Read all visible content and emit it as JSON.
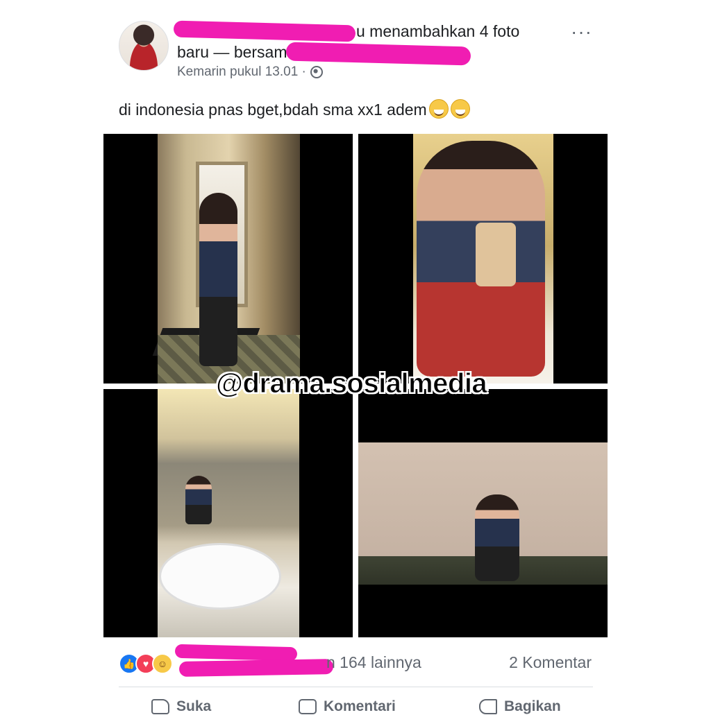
{
  "post": {
    "header_suffix": "u menambahkan 4 foto",
    "header_line2": "baru — bersam",
    "timestamp": "Kemarin pukul 13.01 ·",
    "more_icon": "···",
    "caption": "di indonesia pnas bget,bdah sma xx1 adem"
  },
  "photos": [
    {
      "name": "photo-mirror-selfie-hallway"
    },
    {
      "name": "photo-selfie-closeup"
    },
    {
      "name": "photo-restroom-sink"
    },
    {
      "name": "photo-sitting-by-wall"
    }
  ],
  "watermark": "@drama.sosialmedia",
  "stats": {
    "reaction_suffix": "n 164 lainnya",
    "comments": "2 Komentar",
    "reaction_icons": [
      "like-icon",
      "love-icon",
      "haha-icon"
    ]
  },
  "actions": {
    "like": "Suka",
    "comment": "Komentari",
    "share": "Bagikan"
  },
  "colors": {
    "redaction": "#f01db2",
    "secondary_text": "#616770",
    "like_blue": "#1877f2",
    "love_red": "#f33e58"
  }
}
